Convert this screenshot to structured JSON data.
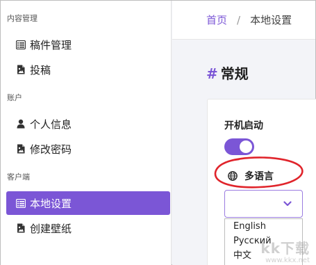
{
  "sidebar": {
    "sections": [
      {
        "title": "内容管理",
        "items": [
          {
            "label": "稿件管理",
            "icon": "list-icon"
          },
          {
            "label": "投稿",
            "icon": "image-file-icon"
          }
        ]
      },
      {
        "title": "账户",
        "items": [
          {
            "label": "个人信息",
            "icon": "user-icon"
          },
          {
            "label": "修改密码",
            "icon": "image-file-icon"
          }
        ]
      },
      {
        "title": "客户端",
        "items": [
          {
            "label": "本地设置",
            "icon": "list-icon",
            "active": true
          },
          {
            "label": "创建壁纸",
            "icon": "image-file-icon"
          }
        ]
      }
    ]
  },
  "breadcrumb": {
    "home": "首页",
    "separator": "/",
    "current": "本地设置"
  },
  "page": {
    "hash": "#",
    "title": "常规"
  },
  "settings": {
    "autostart_label": "开机启动",
    "autostart_enabled": true,
    "language_label": "多语言",
    "language_value": "",
    "language_options": [
      "English",
      "Русский",
      "中文"
    ]
  },
  "watermark": {
    "text": "kk下载",
    "url": "www.kkx.net"
  },
  "colors": {
    "accent": "#7b56d6",
    "annotation": "#e0242b"
  }
}
